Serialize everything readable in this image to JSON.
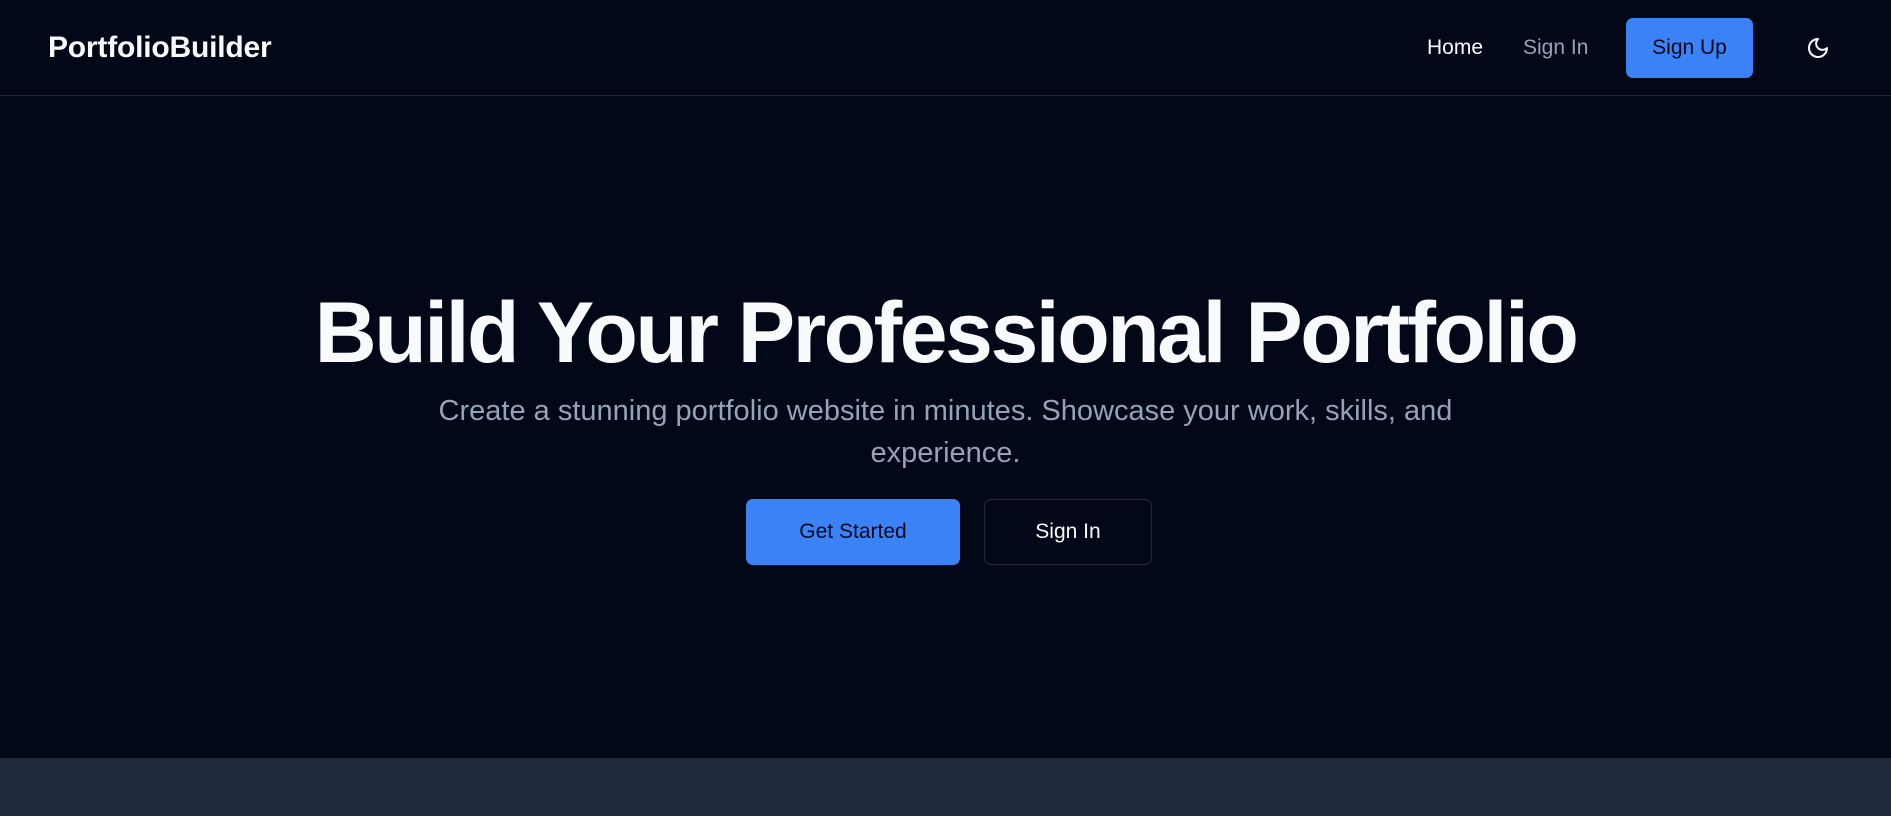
{
  "navbar": {
    "brand": "PortfolioBuilder",
    "links": {
      "home": "Home",
      "sign_in": "Sign In",
      "sign_up": "Sign Up"
    },
    "theme_toggle_icon": "moon-icon"
  },
  "hero": {
    "title": "Build Your Professional Portfolio",
    "subtitle": "Create a stunning portfolio website in minutes. Showcase your work, skills, and experience.",
    "primary_button": "Get Started",
    "secondary_button": "Sign In"
  },
  "colors": {
    "background": "#020817",
    "accent": "#3b82f6",
    "muted_text": "#94a3b8",
    "border": "#1e293b",
    "section_background": "#1e293b"
  }
}
